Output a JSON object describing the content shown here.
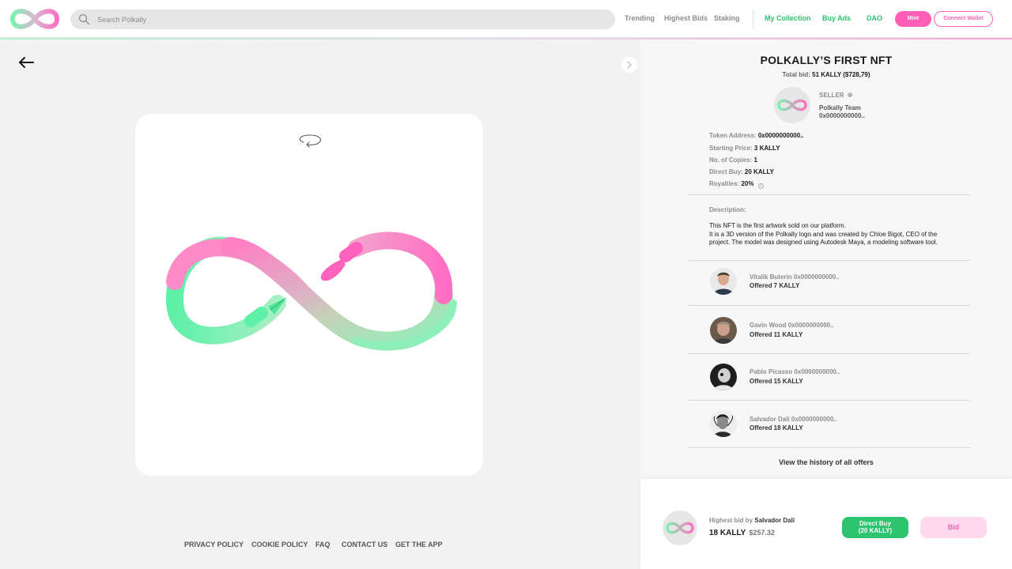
{
  "header": {
    "search_placeholder": "Search Polkally",
    "nav": [
      "Trending",
      "Highest Bids",
      "Staking"
    ],
    "nav_green": [
      "My Collection",
      "Buy Ads",
      "DAO"
    ],
    "mint_label": "Mint",
    "connect_label": "Connect Wallet"
  },
  "footer": {
    "links": [
      "PRIVACY POLICY",
      "COOKIE POLICY",
      "FAQ",
      "CONTACT US",
      "GET THE APP"
    ]
  },
  "nft": {
    "title": "POLKALLY’S FIRST NFT",
    "total_bid_label": "Total bid:",
    "total_bid_value": "51 KALLY ($728,79)",
    "seller_label": "SELLER",
    "seller_name": "Polkally Team",
    "seller_address": "0x0000000000..",
    "details": [
      {
        "label": "Token Address:",
        "value": "0x0000000000.."
      },
      {
        "label": "Starting Price:",
        "value": "3 KALLY"
      },
      {
        "label": "No. of Copies:",
        "value": "1"
      },
      {
        "label": "Direct Buy:",
        "value": "20 KALLY"
      },
      {
        "label": "Royalties:",
        "value": "20%"
      }
    ],
    "description_label": "Description:",
    "description_lines": [
      "This NFT is the first artwork sold on our platform.",
      "It is a 3D version of the Polkally logo and was created by Chloe Bigot, CEO of the project. The model was designed using Autodesk Maya, a modeling software tool."
    ]
  },
  "offers": [
    {
      "name": "Vitalik Buterin 0x0000000000..",
      "amount": "Offered 7 KALLY"
    },
    {
      "name": "Gavin Wood 0x0000000000..",
      "amount": "Offered 11 KALLY"
    },
    {
      "name": "Pablo Picasso 0x0000000000..",
      "amount": "Offered 15 KALLY"
    },
    {
      "name": "Salvador Dali 0x0000000000..",
      "amount": "Offered 18 KALLY"
    }
  ],
  "history_link": "View the history of all offers",
  "bid_bar": {
    "highest_label": "Highest bid by",
    "highest_bidder": "Salvador Dali",
    "highest_amount": "18 KALLY",
    "highest_usd": "$257.32",
    "direct_buy_line1": "Direct Buy",
    "direct_buy_line2": "(20 KALLY)",
    "bid_label": "Bid"
  },
  "colors": {
    "accent_pink": "#ff5fb7",
    "accent_green": "#2cc46e",
    "logo_gradient": [
      "#7ff0b4",
      "#ff6fc2"
    ]
  }
}
